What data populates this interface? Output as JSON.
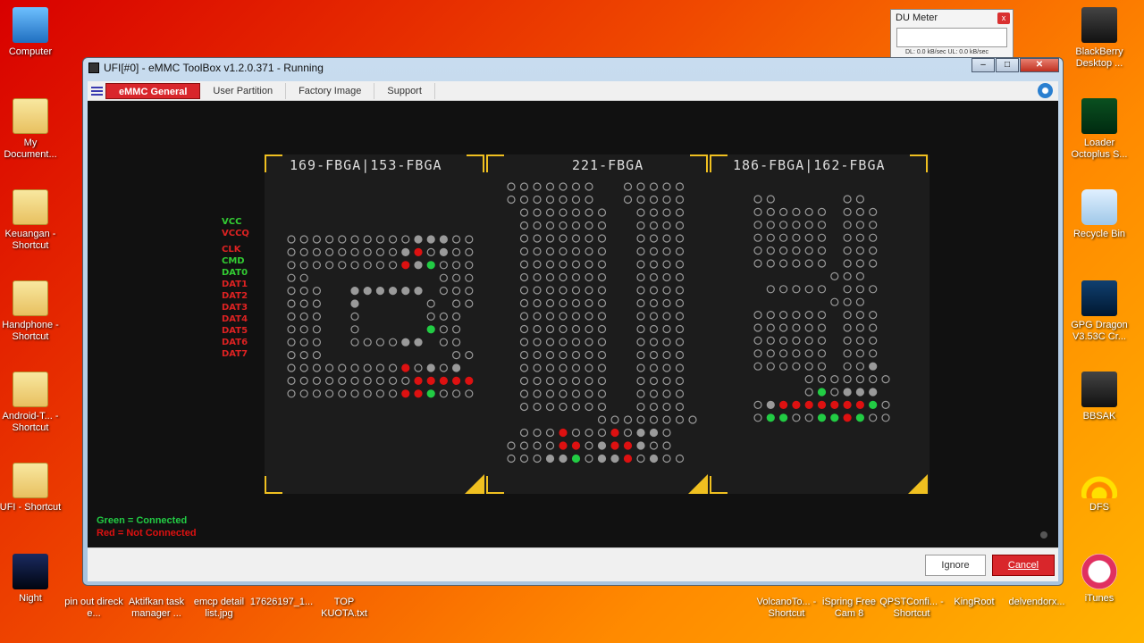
{
  "desktop_left": [
    {
      "label": "Computer",
      "icon": "computer-icon"
    },
    {
      "label": "My Document...",
      "icon": "folder-icon"
    },
    {
      "label": "Keuangan - Shortcut",
      "icon": "folder-icon"
    },
    {
      "label": "Handphone - Shortcut",
      "icon": "folder-icon"
    },
    {
      "label": "Android-T... - Shortcut",
      "icon": "folder-icon"
    },
    {
      "label": "UFI - Shortcut",
      "icon": "folder-icon"
    },
    {
      "label": "Night",
      "icon": "image-icon"
    }
  ],
  "desktop_right": [
    {
      "label": "BlackBerry Desktop ...",
      "icon": "blackberry-icon"
    },
    {
      "label": "Loader Octoplus S...",
      "icon": "octoplus-icon"
    },
    {
      "label": "Recycle Bin",
      "icon": "recycle-bin-icon"
    },
    {
      "label": "GPG Dragon V3.53C Cr...",
      "icon": "dragon-icon"
    },
    {
      "label": "BBSAK",
      "icon": "bbsak-icon"
    },
    {
      "label": "DFS",
      "icon": "wifi-icon"
    },
    {
      "label": "iTunes",
      "icon": "itunes-icon"
    }
  ],
  "desktop_bottom": [
    {
      "label": "pin out direck e...",
      "icon": "file-icon"
    },
    {
      "label": "Aktifkan task manager ...",
      "icon": "file-icon"
    },
    {
      "label": "emcp detail list.jpg",
      "icon": "file-icon"
    },
    {
      "label": "17626197_1...",
      "icon": "file-icon"
    },
    {
      "label": "TOP KUOTA.txt",
      "icon": "file-icon"
    },
    {
      "label": "VolcanoTo... - Shortcut",
      "icon": "file-icon"
    },
    {
      "label": "iSpring Free Cam 8",
      "icon": "file-icon"
    },
    {
      "label": "QPSTConfi... - Shortcut",
      "icon": "file-icon"
    },
    {
      "label": "KingRoot",
      "icon": "file-icon"
    },
    {
      "label": "delvendorx...",
      "icon": "file-icon"
    }
  ],
  "du_meter": {
    "title": "DU Meter",
    "rates": "DL: 0.0 kB/sec  UL: 0.0 kB/sec"
  },
  "window": {
    "title": "UFI[#0] - eMMC ToolBox v1.2.0.371 - Running",
    "tabs": [
      "eMMC General",
      "User Partition",
      "Factory Image",
      "Support"
    ],
    "active_tab": "eMMC General"
  },
  "panels": [
    {
      "title": "169-FBGA|153-FBGA"
    },
    {
      "title": "221-FBGA"
    },
    {
      "title": "186-FBGA|162-FBGA"
    }
  ],
  "signals": [
    {
      "label": "VCC",
      "color": "#33cc33"
    },
    {
      "label": "VCCQ",
      "color": "#dd2222"
    },
    {
      "label": "CLK",
      "color": "#dd2222"
    },
    {
      "label": "CMD",
      "color": "#33cc33"
    },
    {
      "label": "DAT0",
      "color": "#33cc33"
    },
    {
      "label": "DAT1",
      "color": "#dd2222"
    },
    {
      "label": "DAT2",
      "color": "#dd2222"
    },
    {
      "label": "DAT3",
      "color": "#dd2222"
    },
    {
      "label": "DAT4",
      "color": "#dd2222"
    },
    {
      "label": "DAT5",
      "color": "#dd2222"
    },
    {
      "label": "DAT6",
      "color": "#dd2222"
    },
    {
      "label": "DAT7",
      "color": "#dd2222"
    }
  ],
  "legend": {
    "green": "Green = Connected",
    "red": "Red = Not Connected"
  },
  "buttons": {
    "ignore": "Ignore",
    "cancel": "Cancel"
  },
  "colors": {
    "connected": "#22cc44",
    "not_connected": "#dd1111",
    "pad_active": "#9a9a9a",
    "accent": "#f0c020"
  }
}
